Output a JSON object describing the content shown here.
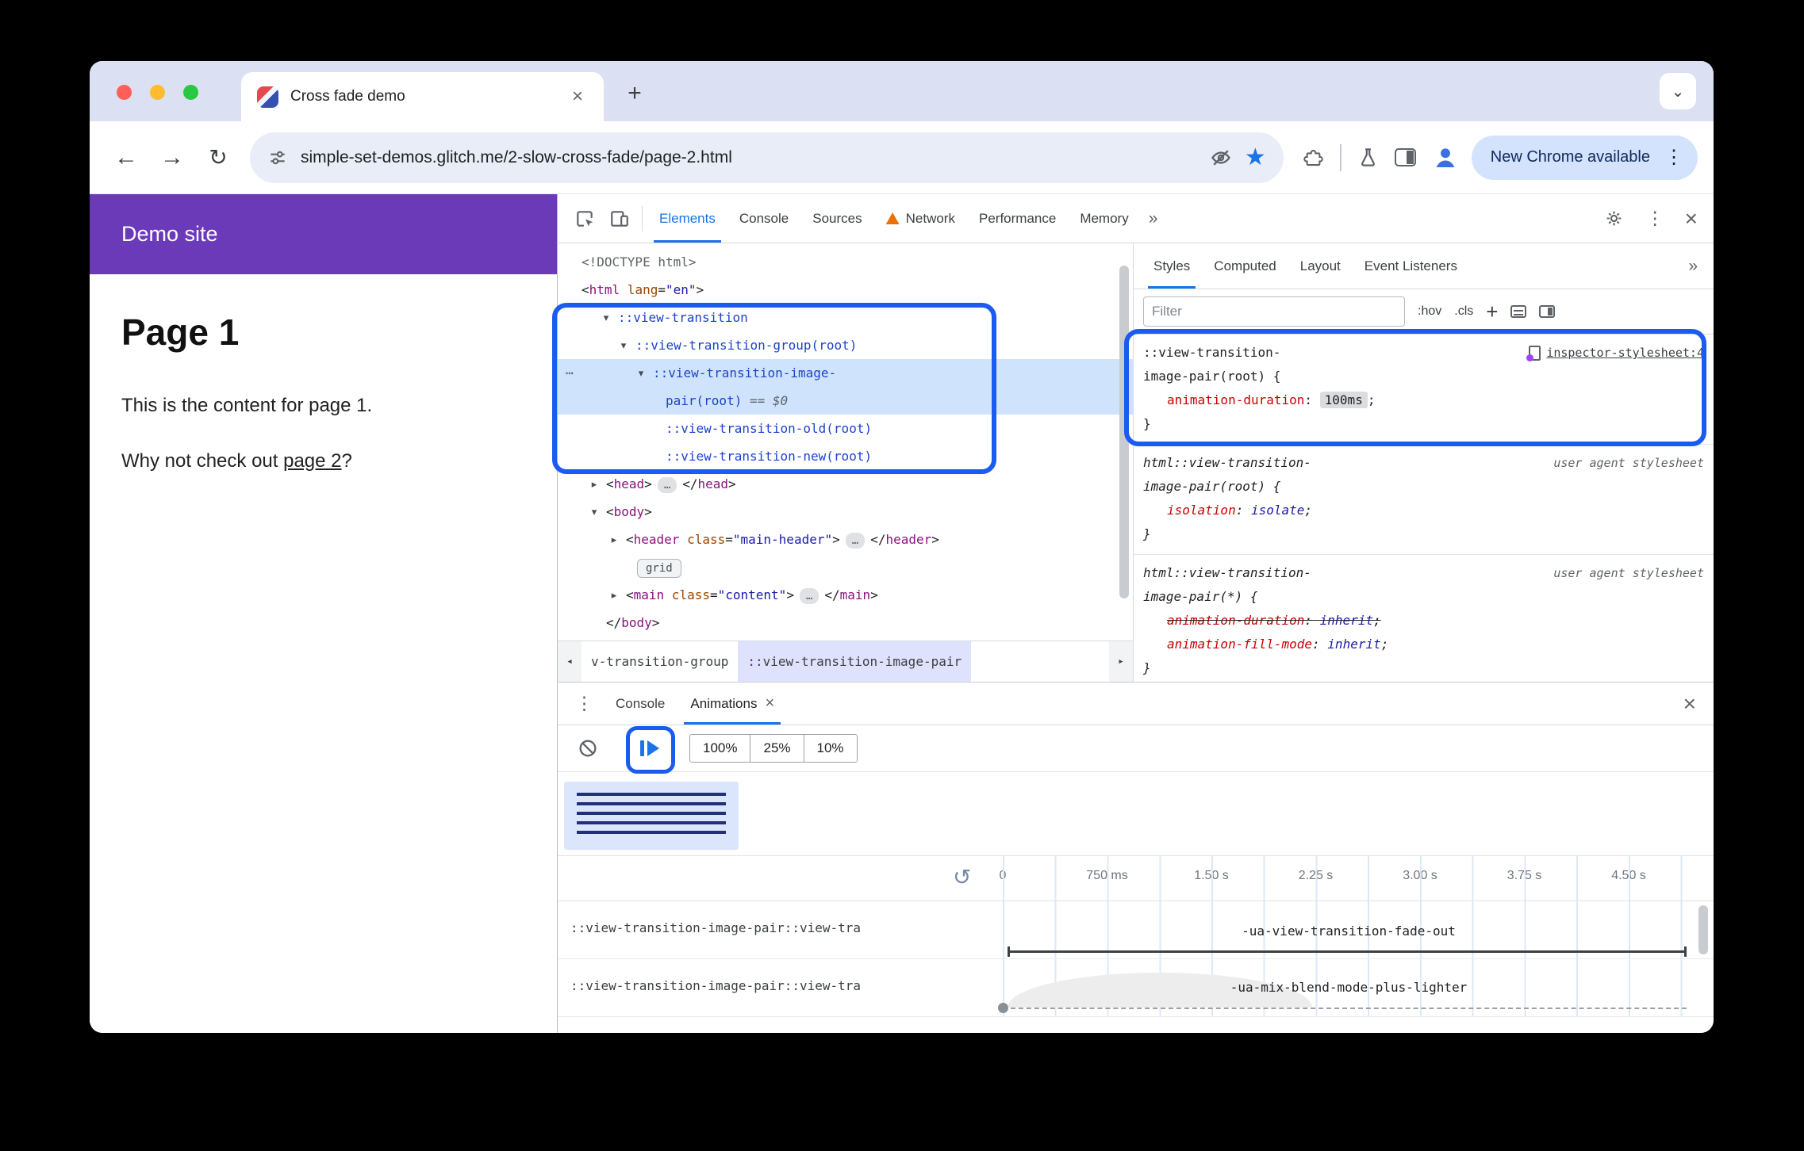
{
  "icons": {
    "back": "←",
    "forward": "→",
    "reload": "↻",
    "star": "★",
    "kebab-v": "⋮",
    "kebab-h": "⋯",
    "close": "×",
    "plus": "+",
    "chevron-down": "⌄",
    "overflow": "»",
    "replay": "↺",
    "crumb-left": "◂",
    "crumb-right": "▸",
    "ellipsis": "…"
  },
  "colors": {
    "accent_blue": "#1a73e8",
    "annotation_blue": "#1b5cf0",
    "page_header_purple": "#6b3ab8",
    "selected_dom_row": "#cfe4fc"
  },
  "browser": {
    "tab_title": "Cross fade demo",
    "url": "simple-set-demos.glitch.me/2-slow-cross-fade/page-2.html",
    "update_button": "New Chrome available"
  },
  "page": {
    "site_header": "Demo site",
    "title": "Page 1",
    "paragraph": "This is the content for page 1.",
    "cta_prefix": "Why not check out ",
    "cta_link": "page 2",
    "cta_suffix": "?"
  },
  "devtools": {
    "tabs": [
      {
        "label": "Elements",
        "selected": true
      },
      {
        "label": "Console"
      },
      {
        "label": "Sources"
      },
      {
        "label": "Network",
        "warning": true
      },
      {
        "label": "Performance"
      },
      {
        "label": "Memory"
      }
    ],
    "more_tabs": "»",
    "elements": {
      "rows": [
        {
          "indent": 30,
          "tokens": [
            [
              "gray",
              "<!DOCTYPE html>"
            ]
          ]
        },
        {
          "indent": 30,
          "tokens": [
            [
              "punct",
              "<"
            ],
            [
              "tag",
              "html"
            ],
            [
              "attr",
              " lang"
            ],
            [
              "punct",
              "="
            ],
            [
              "val",
              "\"en\""
            ],
            [
              "punct",
              ">"
            ]
          ]
        },
        {
          "indent": 76,
          "arrow": "down",
          "tokens": [
            [
              "pseudo",
              "::view-transition"
            ]
          ]
        },
        {
          "indent": 98,
          "arrow": "down",
          "tokens": [
            [
              "pseudo",
              "::view-transition-group(root)"
            ]
          ]
        },
        {
          "indent": 120,
          "arrow": "down",
          "kebab": true,
          "selected": true,
          "tokens": [
            [
              "pseudo",
              "::view-transition-image-"
            ]
          ]
        },
        {
          "indent": 136,
          "selected": true,
          "tokens": [
            [
              "pseudo",
              "pair(root)"
            ],
            [
              "grayit",
              " == $0"
            ]
          ]
        },
        {
          "indent": 136,
          "tokens": [
            [
              "pseudo",
              "::view-transition-old(root)"
            ]
          ]
        },
        {
          "indent": 136,
          "tokens": [
            [
              "pseudo",
              "::view-transition-new(root)"
            ]
          ]
        },
        {
          "indent": 61,
          "arrow": "right",
          "tokens": [
            [
              "punct",
              "<"
            ],
            [
              "tag",
              "head"
            ],
            [
              "punct",
              ">"
            ],
            [
              "pill",
              "…"
            ],
            [
              "punct",
              "</"
            ],
            [
              "tag",
              "head"
            ],
            [
              "punct",
              ">"
            ]
          ]
        },
        {
          "indent": 61,
          "arrow": "down",
          "tokens": [
            [
              "punct",
              "<"
            ],
            [
              "tag",
              "body"
            ],
            [
              "punct",
              ">"
            ]
          ]
        },
        {
          "indent": 86,
          "arrow": "right",
          "tokens": [
            [
              "punct",
              "<"
            ],
            [
              "tag",
              "header"
            ],
            [
              "attr",
              " class"
            ],
            [
              "punct",
              "="
            ],
            [
              "val",
              "\"main-header\""
            ],
            [
              "punct",
              ">"
            ],
            [
              "pill",
              "…"
            ],
            [
              "punct",
              "</"
            ],
            [
              "tag",
              "header"
            ],
            [
              "punct",
              ">"
            ]
          ]
        },
        {
          "indent": 100,
          "tokens": [
            [
              "badge",
              "grid"
            ]
          ]
        },
        {
          "indent": 86,
          "arrow": "right",
          "tokens": [
            [
              "punct",
              "<"
            ],
            [
              "tag",
              "main"
            ],
            [
              "attr",
              " class"
            ],
            [
              "punct",
              "="
            ],
            [
              "val",
              "\"content\""
            ],
            [
              "punct",
              ">"
            ],
            [
              "pill",
              "…"
            ],
            [
              "punct",
              "</"
            ],
            [
              "tag",
              "main"
            ],
            [
              "punct",
              ">"
            ]
          ]
        },
        {
          "indent": 61,
          "tokens": [
            [
              "punct",
              "</"
            ],
            [
              "tag",
              "body"
            ],
            [
              "punct",
              ">"
            ]
          ]
        }
      ],
      "breadcrumbs": [
        {
          "label": "v-transition-group"
        },
        {
          "label": "::view-transition-image-pair",
          "selected": true
        }
      ]
    },
    "styles": {
      "tabs": [
        {
          "label": "Styles",
          "selected": true
        },
        {
          "label": "Computed"
        },
        {
          "label": "Layout"
        },
        {
          "label": "Event Listeners"
        }
      ],
      "more_tabs": "»",
      "filter_placeholder": "Filter",
      "pseudo_toggle": ":hov",
      "class_toggle": ".cls",
      "rules": [
        {
          "italic": false,
          "selector_lines": [
            "::view-transition-",
            "image-pair(root) {"
          ],
          "origin": {
            "type": "link",
            "label": "inspector-stylesheet:4"
          },
          "decls": [
            {
              "name": "animation-duration",
              "value": "100ms",
              "chip": true
            }
          ],
          "close": "}"
        },
        {
          "italic": true,
          "selector_lines": [
            "html::view-transition-",
            "image-pair(root) {"
          ],
          "origin": {
            "type": "text",
            "label": "user agent stylesheet"
          },
          "decls": [
            {
              "name": "isolation",
              "value": "isolate"
            }
          ],
          "close": "}"
        },
        {
          "italic": true,
          "selector_lines": [
            "html::view-transition-",
            "image-pair(*) {"
          ],
          "origin": {
            "type": "text",
            "label": "user agent stylesheet"
          },
          "decls": [
            {
              "name": "animation-duration",
              "value": "inherit",
              "struck": true
            },
            {
              "name": "animation-fill-mode",
              "value": "inherit"
            }
          ],
          "close": "}"
        }
      ]
    },
    "drawer": {
      "console_tab": "Console",
      "animations_tab": "Animations",
      "speeds": [
        "100%",
        "25%",
        "10%"
      ],
      "timeline_labels": [
        "0",
        "750 ms",
        "1.50 s",
        "2.25 s",
        "3.00 s",
        "3.75 s",
        "4.50 s"
      ],
      "animation_rows": [
        {
          "target": "::view-transition-image-pair::view-tra",
          "name": "-ua-view-transition-fade-out"
        },
        {
          "target": "::view-transition-image-pair::view-tra",
          "name": "-ua-mix-blend-mode-plus-lighter"
        }
      ]
    }
  }
}
